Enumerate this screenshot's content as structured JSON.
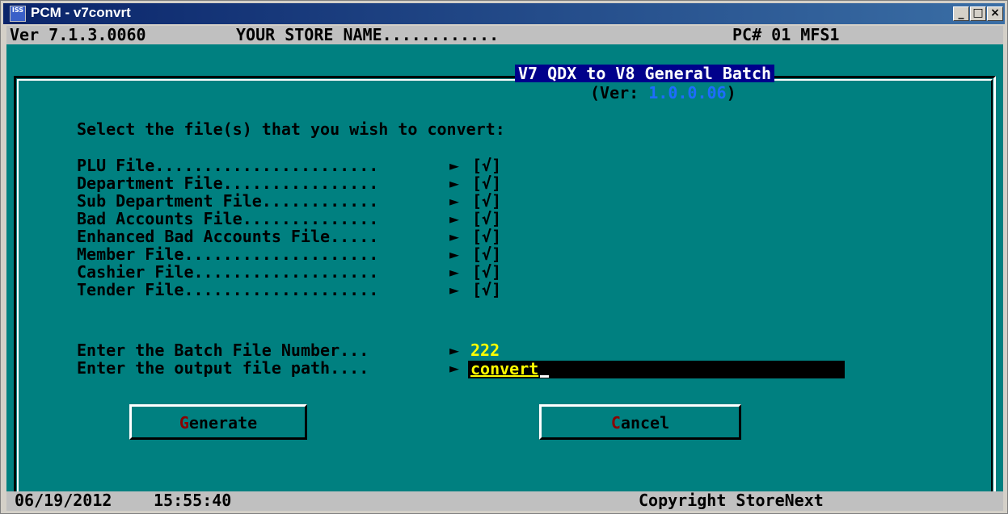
{
  "window": {
    "title": "PCM - v7convrt",
    "icon_label": "ISS"
  },
  "header": {
    "version": "Ver 7.1.3.0060",
    "store_name": "YOUR STORE NAME............",
    "pc": "PC# 01 MFS1"
  },
  "dialog": {
    "title": "V7 QDX to V8 General Batch",
    "ver_prefix": "(Ver: ",
    "ver_number": "1.0.0.06",
    "ver_suffix": ")",
    "prompt": "Select the file(s) that you wish to convert:",
    "files": [
      {
        "label": "PLU File.......................",
        "value": "[√]"
      },
      {
        "label": "Department File................",
        "value": "[√]"
      },
      {
        "label": "Sub Department File............",
        "value": "[√]"
      },
      {
        "label": "Bad Accounts File..............",
        "value": "[√]"
      },
      {
        "label": "Enhanced Bad Accounts File.....",
        "value": "[√]"
      },
      {
        "label": "Member File....................",
        "value": "[√]"
      },
      {
        "label": "Cashier File...................",
        "value": "[√]"
      },
      {
        "label": "Tender File....................",
        "value": "[√]"
      }
    ],
    "arrow": "►",
    "batch_label": "Enter the Batch File Number...",
    "batch_value": "222",
    "path_label": "Enter the output file path....",
    "path_value": "convert",
    "buttons": {
      "generate_hot": "G",
      "generate_rest": "enerate",
      "cancel_hot": "C",
      "cancel_rest": "ancel"
    }
  },
  "status": {
    "date": "06/19/2012",
    "time": "15:55:40",
    "copyright": "Copyright StoreNext"
  },
  "colors": {
    "console_bg": "#008080",
    "title_bg": "#00008b",
    "input_value": "#ffff00",
    "version_num": "#1e6cff",
    "hotkey": "#8b0000"
  }
}
